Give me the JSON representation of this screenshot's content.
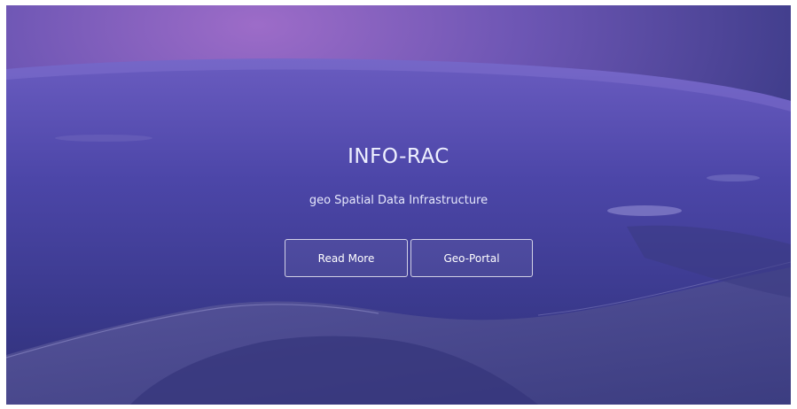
{
  "hero": {
    "title": "INFO-RAC",
    "subtitle": "geo Spatial Data Infrastructure",
    "buttons": {
      "read_more": "Read More",
      "geo_portal": "Geo-Portal"
    }
  },
  "colors": {
    "sky_top": "#8a63c4",
    "sky_mid": "#6a58b8",
    "ocean": "#3a3a93",
    "land": "#4a4a8c",
    "text": "#eef0ff"
  },
  "icons": [
    "earth-from-space-image"
  ]
}
